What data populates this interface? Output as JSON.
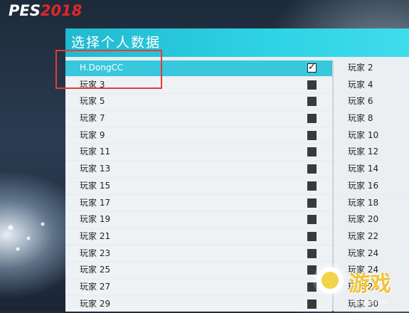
{
  "logo": {
    "pes": "PES",
    "year": "2018"
  },
  "panel": {
    "title": "选择个人数据"
  },
  "left_list": [
    {
      "label": "H.DongCC",
      "checked": true,
      "selected": true
    },
    {
      "label": "玩家 3",
      "checked": false
    },
    {
      "label": "玩家 5",
      "checked": false
    },
    {
      "label": "玩家 7",
      "checked": false
    },
    {
      "label": "玩家 9",
      "checked": false
    },
    {
      "label": "玩家 11",
      "checked": false
    },
    {
      "label": "玩家 13",
      "checked": false
    },
    {
      "label": "玩家 15",
      "checked": false
    },
    {
      "label": "玩家 17",
      "checked": false
    },
    {
      "label": "玩家 19",
      "checked": false
    },
    {
      "label": "玩家 21",
      "checked": false
    },
    {
      "label": "玩家 23",
      "checked": false
    },
    {
      "label": "玩家 25",
      "checked": false
    },
    {
      "label": "玩家 27",
      "checked": false
    },
    {
      "label": "玩家 29",
      "checked": false
    }
  ],
  "right_list": [
    {
      "label": "玩家 2"
    },
    {
      "label": "玩家 4"
    },
    {
      "label": "玩家 6"
    },
    {
      "label": "玩家 8"
    },
    {
      "label": "玩家 10"
    },
    {
      "label": "玩家 12"
    },
    {
      "label": "玩家 14"
    },
    {
      "label": "玩家 16"
    },
    {
      "label": "玩家 18"
    },
    {
      "label": "玩家 20"
    },
    {
      "label": "玩家 22"
    },
    {
      "label": "玩家 24"
    },
    {
      "label": "玩家 24"
    },
    {
      "label": "玩家 26"
    },
    {
      "label": "玩家 30"
    }
  ],
  "checkmark_glyph": "✓",
  "watermark": {
    "text": "游戏",
    "url": "9game.com"
  },
  "colors": {
    "header": "#2ed3e4",
    "selected_row": "#38c7dc",
    "highlight": "#e53a3a",
    "logo_red": "#e0262c"
  }
}
